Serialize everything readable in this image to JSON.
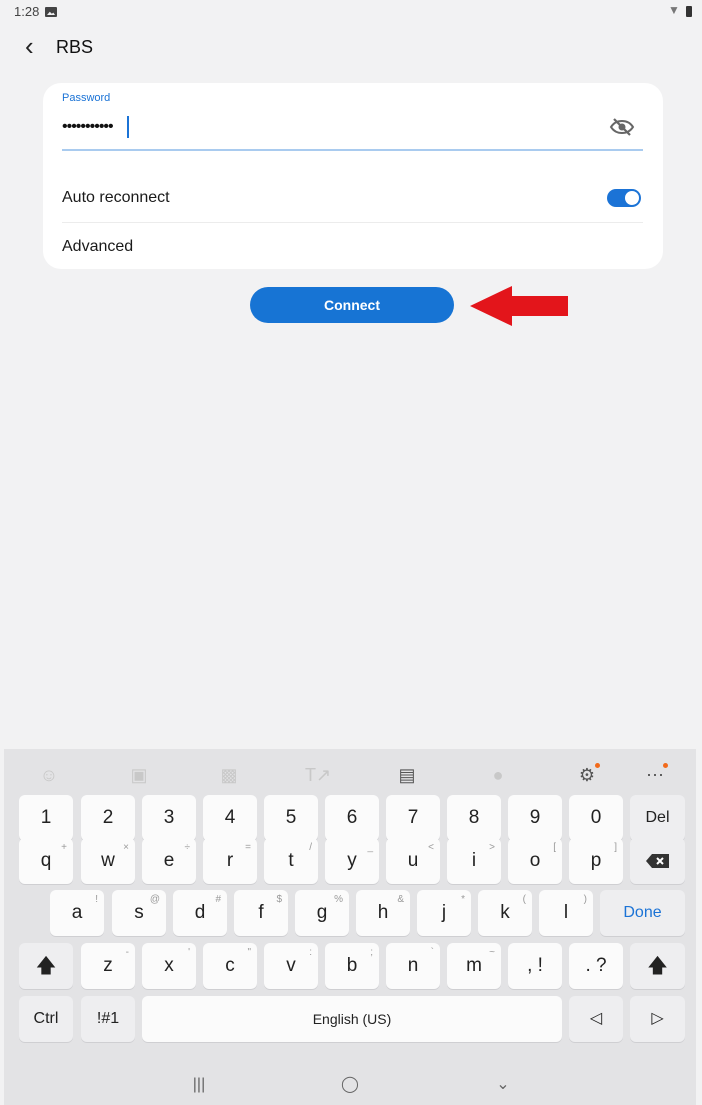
{
  "status_bar": {
    "time": "1:28"
  },
  "header": {
    "title": "RBS"
  },
  "card": {
    "password_label": "Password",
    "password_value": "•••••••••••",
    "auto_reconnect_label": "Auto reconnect",
    "auto_reconnect_on": true,
    "advanced_label": "Advanced"
  },
  "connect_label": "Connect",
  "colors": {
    "accent": "#1774d4",
    "arrow": "#e3151b"
  },
  "toolbar": [
    "emoji-icon",
    "sticker-icon",
    "gif-icon",
    "text-style-icon",
    "clipboard-icon",
    "mic-icon",
    "settings-icon",
    "more-icon"
  ],
  "keyboard": {
    "row1": [
      "1",
      "2",
      "3",
      "4",
      "5",
      "6",
      "7",
      "8",
      "9",
      "0",
      "Del"
    ],
    "row2": [
      "q",
      "w",
      "e",
      "r",
      "t",
      "y",
      "u",
      "i",
      "o",
      "p"
    ],
    "row2_sub": [
      "+",
      "×",
      "÷",
      "=",
      "/",
      "_",
      "<",
      ">",
      "[",
      "]"
    ],
    "row3": [
      "a",
      "s",
      "d",
      "f",
      "g",
      "h",
      "j",
      "k",
      "l"
    ],
    "row3_sub": [
      "!",
      "@",
      "#",
      "$",
      "%",
      "&",
      "*",
      "(",
      ")"
    ],
    "done": "Done",
    "row4": [
      "z",
      "x",
      "c",
      "v",
      "b",
      "n",
      "m"
    ],
    "row4_sub": [
      "-",
      "'",
      "\"",
      ":",
      ";",
      "`",
      "~"
    ],
    "comma": ", !",
    "period": ". ?",
    "ctrl": "Ctrl",
    "symbols": "!#1",
    "space": "English (US)"
  }
}
